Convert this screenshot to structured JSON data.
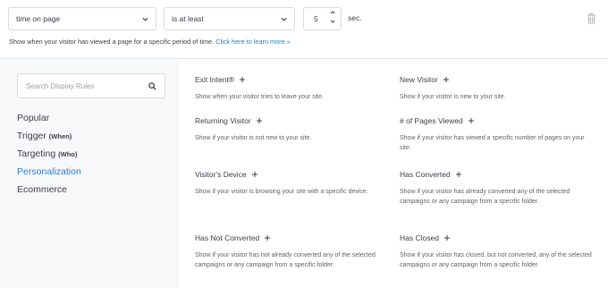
{
  "trigger": {
    "selected": "time on page",
    "condition": "is at least",
    "value": "5",
    "unit": "sec.",
    "description": "Show when your visitor has viewed a page for a specific period of time.",
    "learn_more": "Click here to learn more »"
  },
  "sidebar": {
    "search_placeholder": "Search Display Rules",
    "categories": [
      {
        "label": "Popular",
        "sub": ""
      },
      {
        "label": "Trigger",
        "sub": "(When)"
      },
      {
        "label": "Targeting",
        "sub": "(Who)"
      },
      {
        "label": "Personalization",
        "sub": ""
      },
      {
        "label": "Ecommerce",
        "sub": ""
      }
    ],
    "active_category": "Personalization"
  },
  "rules": [
    {
      "title": "Exit Intent®",
      "desc": "Show when your visitor tries to leave your site."
    },
    {
      "title": "New Visitor",
      "desc": "Show if your visitor is new to your site."
    },
    {
      "title": "Returning Visitor",
      "desc": "Show if your visitor is not new to your site."
    },
    {
      "title": "# of Pages Viewed",
      "desc": "Show if your visitor has viewed a specific number of pages on your site."
    },
    {
      "title": "Visitor's Device",
      "desc": "Show if your visitor is browsing your site with a specific device."
    },
    {
      "title": "Has Converted",
      "desc": "Show if your visitor has already converted any of the selected campaigns or any campaign from a specific folder."
    },
    {
      "title": "Has Not Converted",
      "desc": "Show if your visitor has not already converted any of the selected campaigns or any campaign from a specific folder."
    },
    {
      "title": "Has Closed",
      "desc": "Show if your visitor has closed, but not converted, any of the selected campaigns or any campaign from a specific folder."
    }
  ],
  "colors": {
    "accent": "#2a80c8",
    "panel_bg": "#f7f8fa",
    "text": "#3a3f48"
  },
  "icons": {
    "select": "chevron-down-icon",
    "spinner": "spinner-arrows-icon",
    "delete": "trash-icon",
    "search": "search-icon",
    "add": "plus-icon"
  }
}
